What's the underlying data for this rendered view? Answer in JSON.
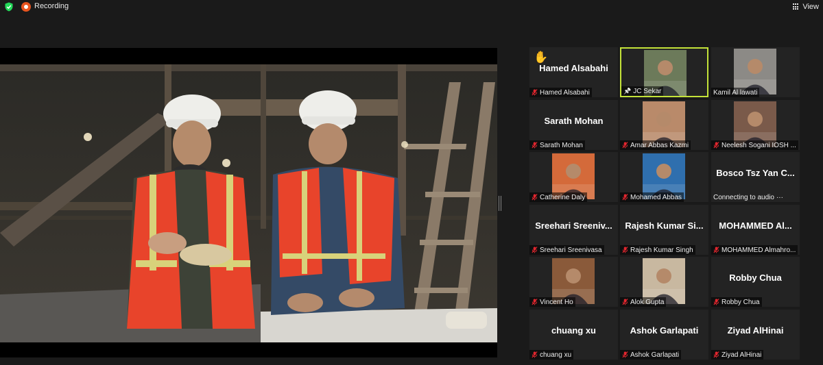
{
  "topbar": {
    "recording_label": "Recording",
    "view_label": "View"
  },
  "shared_screen": {
    "description_icon": "shared-video"
  },
  "participants": [
    {
      "display": "Hamed Alsabahi",
      "label": "Hamed Alsabahi",
      "muted": true,
      "video": false,
      "hand_raised": true
    },
    {
      "display": "",
      "label": "JC Sekar",
      "muted": false,
      "video": true,
      "active_speaker": true,
      "pinned": true
    },
    {
      "display": "",
      "label": "Kamil Al lawati",
      "muted": false,
      "video": true
    },
    {
      "display": "Sarath Mohan",
      "label": "Sarath Mohan",
      "muted": true,
      "video": false
    },
    {
      "display": "",
      "label": "Amar Abbas Kazmi",
      "muted": true,
      "video": true
    },
    {
      "display": "",
      "label": "Neelesh Sogani IOSH ...",
      "muted": true,
      "video": true
    },
    {
      "display": "",
      "label": "Catherine Daly",
      "muted": true,
      "video": true
    },
    {
      "display": "",
      "label": "Mohamed Abbas",
      "muted": true,
      "video": true
    },
    {
      "display": "Bosco Tsz Yan C...",
      "label": "Connecting to audio",
      "muted": false,
      "video": false,
      "connecting": true
    },
    {
      "display": "Sreehari Sreeniv...",
      "label": "Sreehari Sreenivasa",
      "muted": true,
      "video": false
    },
    {
      "display": "Rajesh Kumar Si...",
      "label": "Rajesh Kumar Singh",
      "muted": true,
      "video": false
    },
    {
      "display": "MOHAMMED Al...",
      "label": "MOHAMMED Almahro...",
      "muted": true,
      "video": false
    },
    {
      "display": "",
      "label": "Vincent Ho",
      "muted": true,
      "video": true
    },
    {
      "display": "",
      "label": "Alok Gupta",
      "muted": true,
      "video": true
    },
    {
      "display": "Robby Chua",
      "label": "Robby Chua",
      "muted": true,
      "video": false
    },
    {
      "display": "chuang xu",
      "label": "chuang xu",
      "muted": true,
      "video": false
    },
    {
      "display": "Ashok Garlapati",
      "label": "Ashok Garlapati",
      "muted": true,
      "video": false
    },
    {
      "display": "Ziyad AlHinai",
      "label": "Ziyad AlHinai",
      "muted": true,
      "video": false
    }
  ],
  "colors": {
    "background": "#1a1a1a",
    "tile": "#232323",
    "active_speaker_border": "#c4e339",
    "muted_icon": "#e0262e",
    "recording": "#e8541e",
    "shield": "#23d959"
  }
}
